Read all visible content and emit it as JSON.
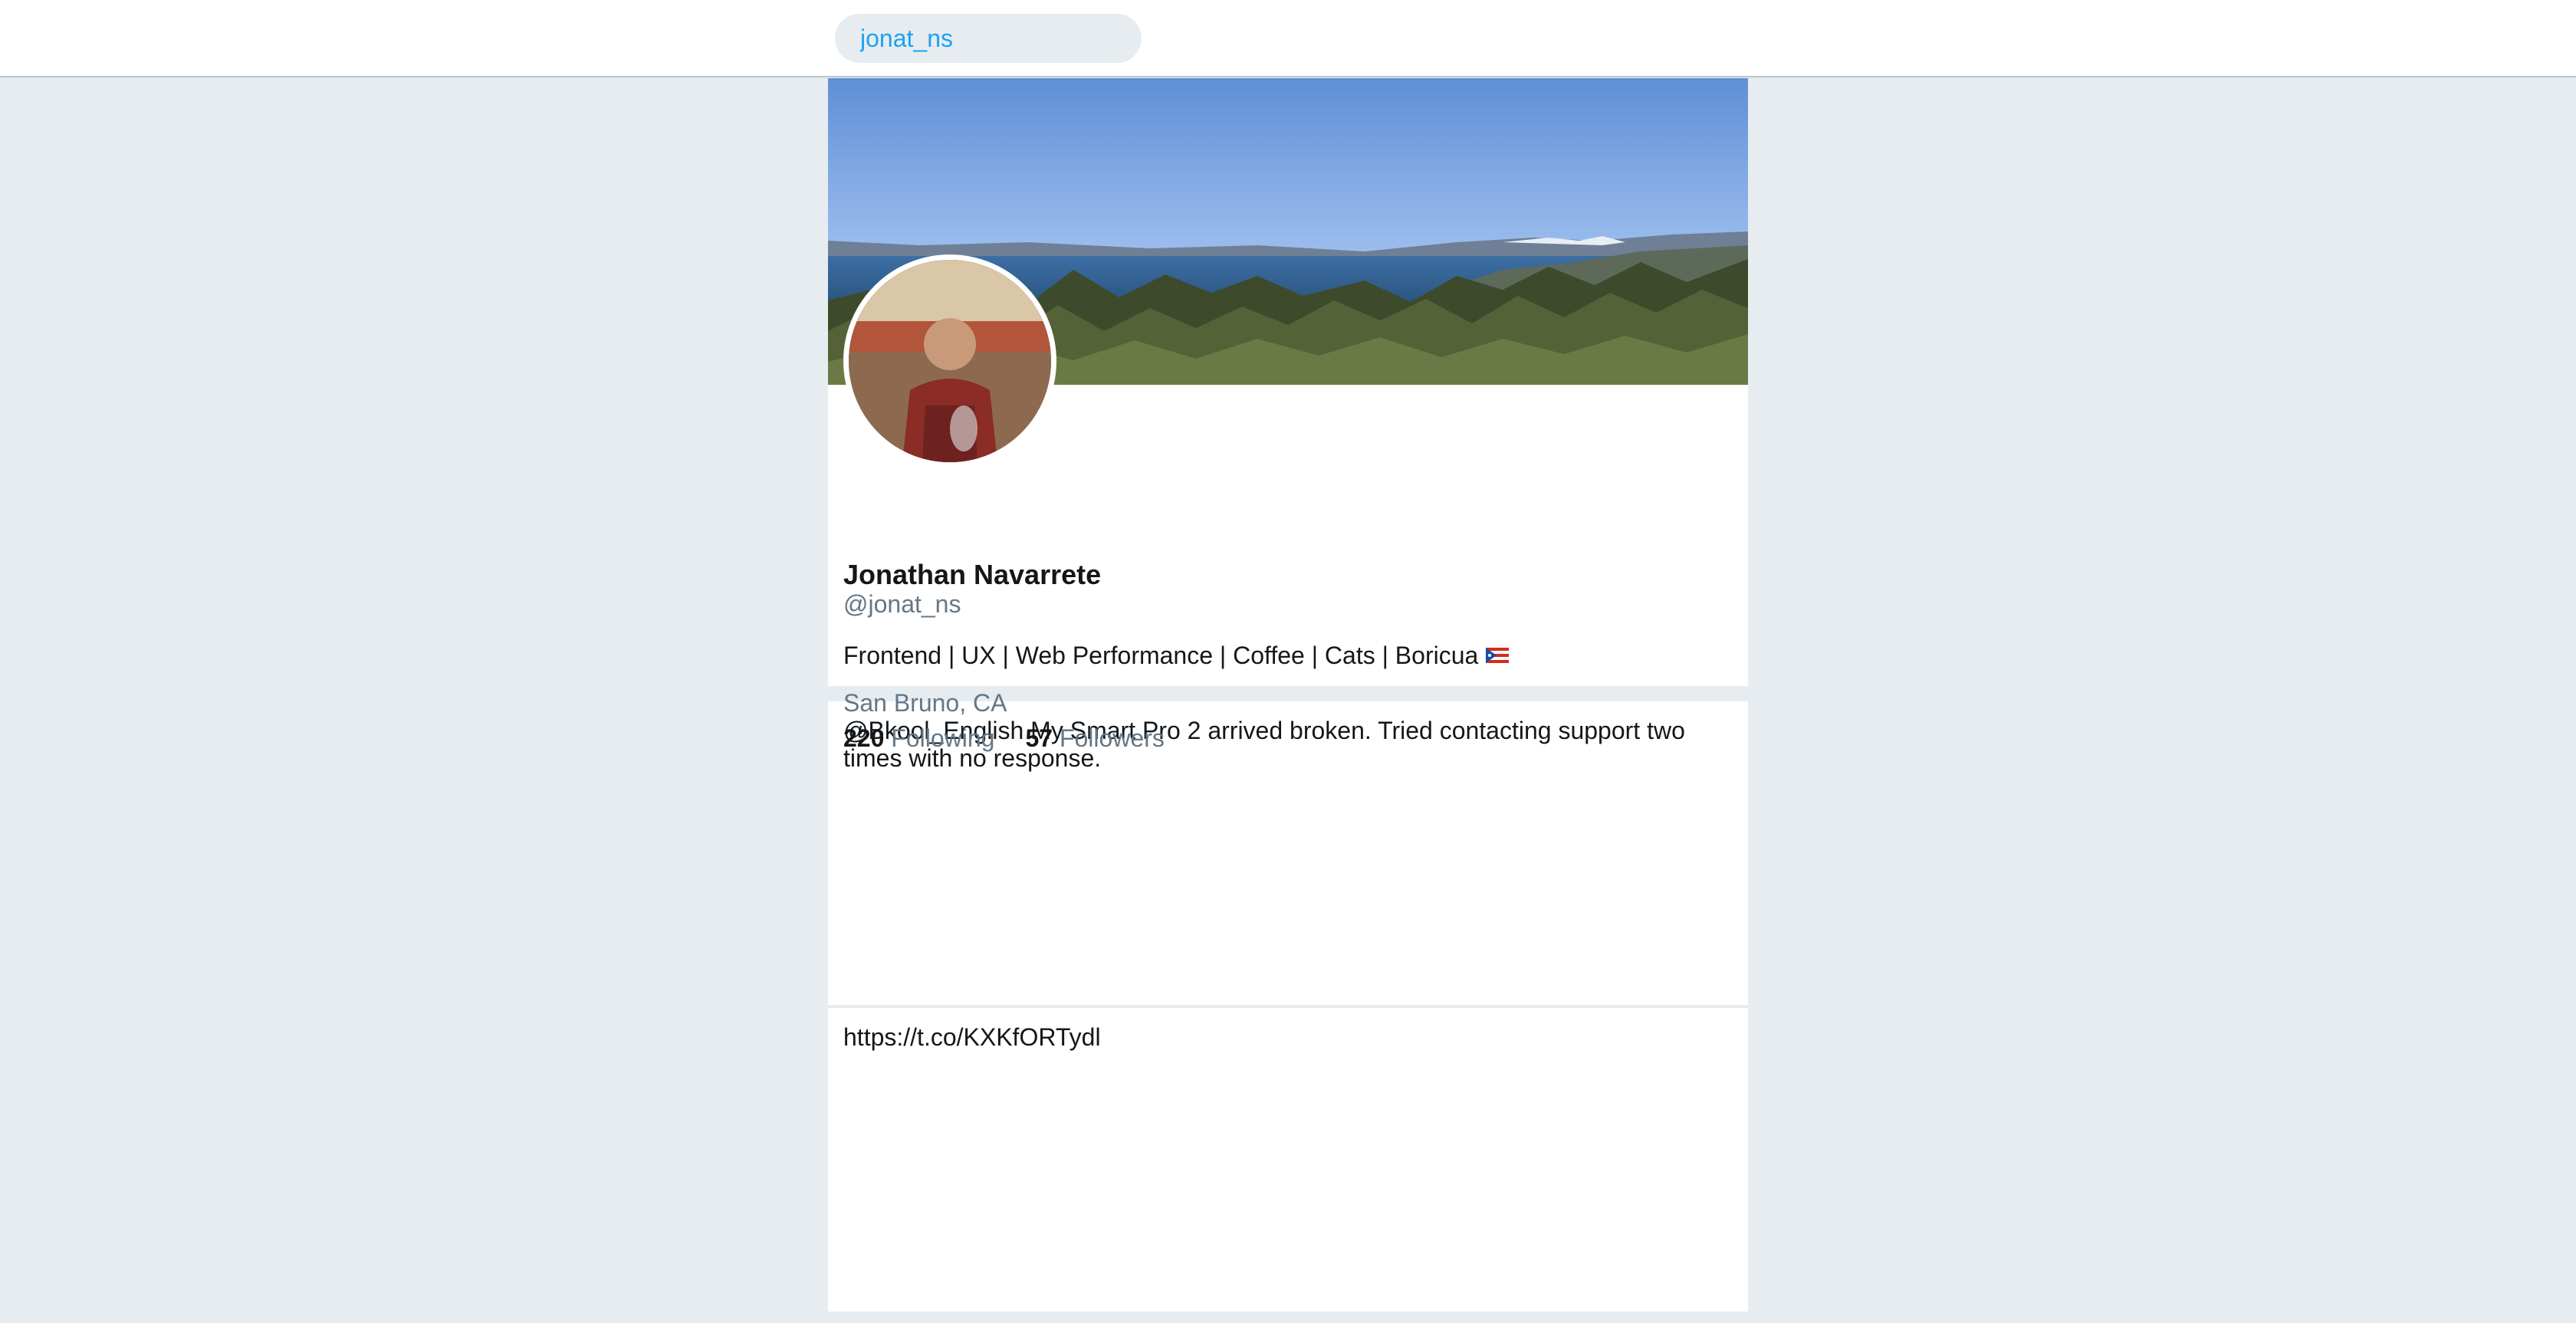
{
  "search": {
    "value": "jonat_ns",
    "icon": "none"
  },
  "profile": {
    "name": "Jonathan Navarrete",
    "handle": "@jonat_ns",
    "bio": "Frontend | UX | Web Performance | Coffee | Cats | Boricua",
    "bio_emoji": "puerto-rico-flag",
    "location": "San Bruno, CA",
    "following_count": "220",
    "following_label": "Following",
    "followers_count": "57",
    "followers_label": "Followers"
  },
  "tweets": [
    {
      "text": "@Bkool_English My Smart Pro 2 arrived broken. Tried contacting support two times with no response."
    },
    {
      "text": "https://t.co/KXKfORTydl"
    }
  ],
  "colors": {
    "page_bg": "#e6ecf0",
    "accent": "#1da1f2",
    "secondary_text": "#657786"
  }
}
